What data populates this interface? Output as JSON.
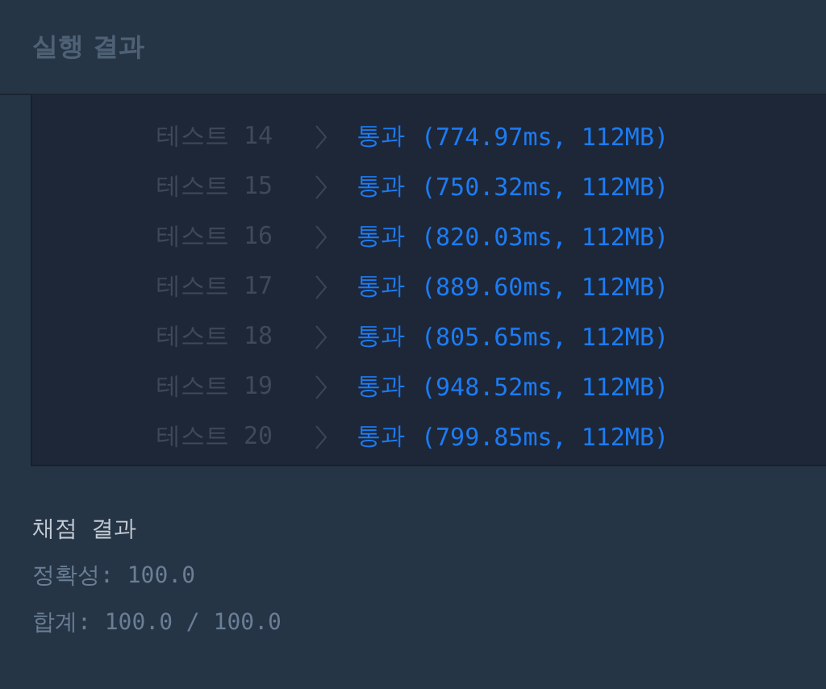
{
  "header": {
    "title": "실행 결과"
  },
  "tests": [
    {
      "label": "테스트 14",
      "status": "통과",
      "result": "(774.97ms, 112MB)"
    },
    {
      "label": "테스트 15",
      "status": "통과",
      "result": "(750.32ms, 112MB)"
    },
    {
      "label": "테스트 16",
      "status": "통과",
      "result": "(820.03ms, 112MB)"
    },
    {
      "label": "테스트 17",
      "status": "통과",
      "result": "(889.60ms, 112MB)"
    },
    {
      "label": "테스트 18",
      "status": "통과",
      "result": "(805.65ms, 112MB)"
    },
    {
      "label": "테스트 19",
      "status": "통과",
      "result": "(948.52ms, 112MB)"
    },
    {
      "label": "테스트 20",
      "status": "통과",
      "result": "(799.85ms, 112MB)"
    }
  ],
  "grading": {
    "title": "채점 결과",
    "lines": [
      "정확성: 100.0",
      "합계: 100.0 / 100.0"
    ]
  }
}
